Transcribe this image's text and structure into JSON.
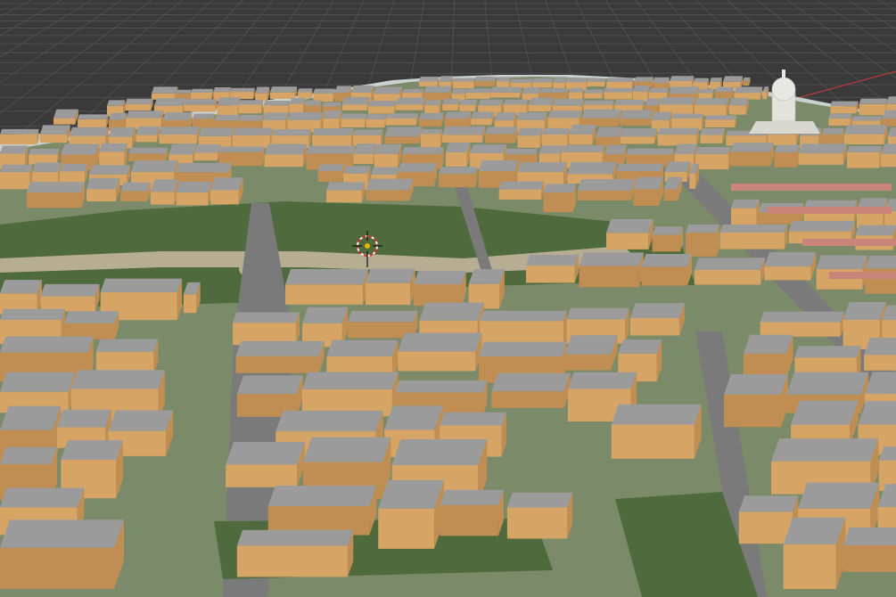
{
  "viewport": {
    "mode": "3d-viewport",
    "background": "#3a3a3a",
    "grid_color": "#545454",
    "x_axis_color": "#b83a3a",
    "ground_color": "#7b8a68",
    "park_color": "#4f6a3c",
    "plaza_color": "#b7ad92",
    "road_color": "#7a7a7a",
    "building_top_color": "#9b9b9b",
    "building_side_color": "#d6a565",
    "building_side_shade": "#c08e52",
    "coastline_color": "#c9d2d0"
  },
  "scene": {
    "cursor_icon": "3d-cursor-icon",
    "landmark": "domed-tower"
  }
}
